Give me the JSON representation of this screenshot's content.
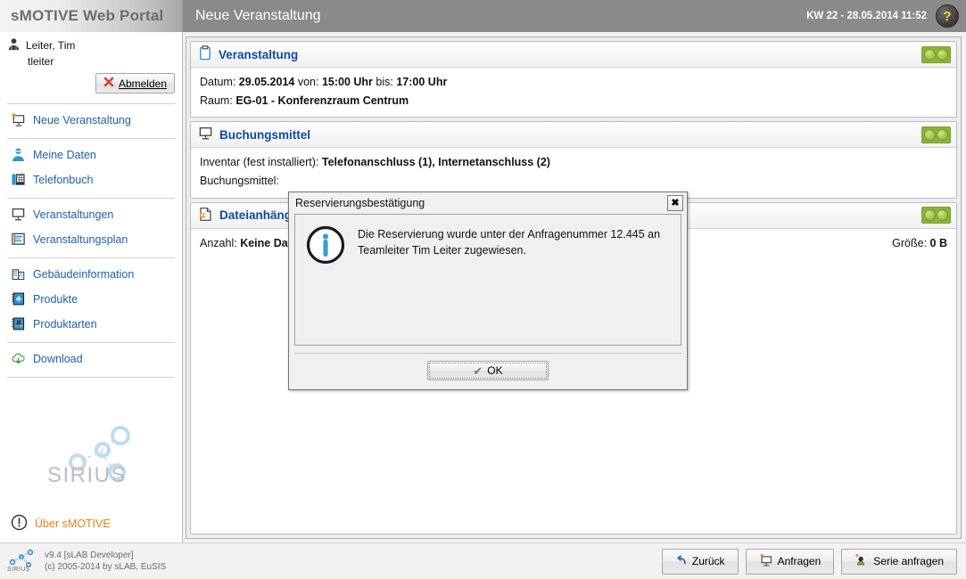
{
  "brand": {
    "title": "sMOTIVE Web Portal"
  },
  "header": {
    "page_title": "Neue Veranstaltung",
    "clock": "KW 22 - 28.05.2014 11:52",
    "help_label": "?"
  },
  "user": {
    "display_name": "Leiter, Tim",
    "username": "tleiter",
    "logout_label": "Abmelden"
  },
  "sidebar": {
    "items": [
      {
        "label": "Neue Veranstaltung",
        "icon": "new-event-icon",
        "sep_after": true
      },
      {
        "label": "Meine Daten",
        "icon": "user-icon",
        "sep_after": false
      },
      {
        "label": "Telefonbuch",
        "icon": "phonebook-icon",
        "sep_after": true
      },
      {
        "label": "Veranstaltungen",
        "icon": "events-icon",
        "sep_after": false
      },
      {
        "label": "Veranstaltungsplan",
        "icon": "event-plan-icon",
        "sep_after": true
      },
      {
        "label": "Gebäudeinformation",
        "icon": "building-icon",
        "sep_after": false
      },
      {
        "label": "Produkte",
        "icon": "products-icon",
        "sep_after": false
      },
      {
        "label": "Produktarten",
        "icon": "product-types-icon",
        "sep_after": true
      },
      {
        "label": "Download",
        "icon": "download-cloud-icon",
        "sep_after": true
      }
    ],
    "logo_text": "SIRIUS",
    "about_label": "Über sMOTIVE"
  },
  "panels": {
    "event": {
      "title": "Veranstaltung",
      "icon": "clipboard-icon",
      "date_label": "Datum:",
      "date_value": "29.05.2014",
      "from_label": "von:",
      "from_value": "15:00 Uhr",
      "to_label": "bis:",
      "to_value": "17:00 Uhr",
      "room_label": "Raum:",
      "room_value": "EG-01 - Konferenzraum Centrum"
    },
    "booking": {
      "title": "Buchungsmittel",
      "icon": "monitor-icon",
      "inventory_label": "Inventar (fest installiert):",
      "inventory_value": "Telefonanschluss (1), Internetanschluss (2)",
      "booking_label": "Buchungsmittel:",
      "booking_value": ""
    },
    "attachments": {
      "title": "Dateianhänge",
      "icon": "attachment-file-icon",
      "count_label": "Anzahl:",
      "count_value": "Keine Dateien",
      "size_label": "Größe:",
      "size_value": "0 B"
    }
  },
  "dialog": {
    "title": "Reservierungsbestätigung",
    "close_label": "✖",
    "icon": "info-icon",
    "message": "Die Reservierung wurde unter der Anfragenummer 12.445 an Teamleiter Tim Leiter zugewiesen.",
    "ok_label": "OK"
  },
  "footer": {
    "logo_text": "SIRIUS",
    "version_line": "v9.4 [sLAB Developer]",
    "copyright_line": "(c) 2005-2014 by sLAB, EuSIS",
    "actions": [
      {
        "label": "Zurück",
        "icon": "back-arrow-icon"
      },
      {
        "label": "Anfragen",
        "icon": "request-icon"
      },
      {
        "label": "Serie anfragen",
        "icon": "series-request-icon"
      }
    ]
  },
  "colors": {
    "accent_blue": "#0b4da2",
    "link_blue": "#1d5fa8",
    "toggle_green": "#8bb43a",
    "about_orange": "#e08214",
    "header_grey": "#8a8a8a"
  }
}
